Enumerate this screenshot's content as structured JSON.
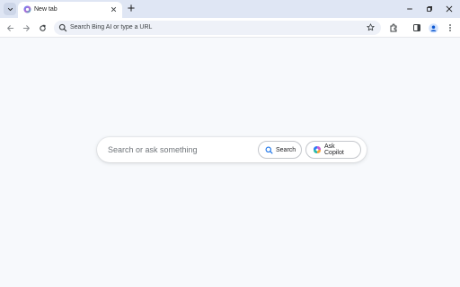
{
  "tabs": [
    {
      "title": "New tab",
      "active": true
    }
  ],
  "omnibox": {
    "placeholder": "Search Bing AI or type a URL"
  },
  "main": {
    "search_placeholder": "Search or ask something",
    "search_button_label": "Search",
    "copilot_button_label": "Ask Copilot"
  },
  "colors": {
    "titlebar": "#dfe6f4",
    "page_background": "#f7f9fc",
    "omnibox_background": "#eef1f8",
    "search_icon_accent": "#1a73e8"
  }
}
